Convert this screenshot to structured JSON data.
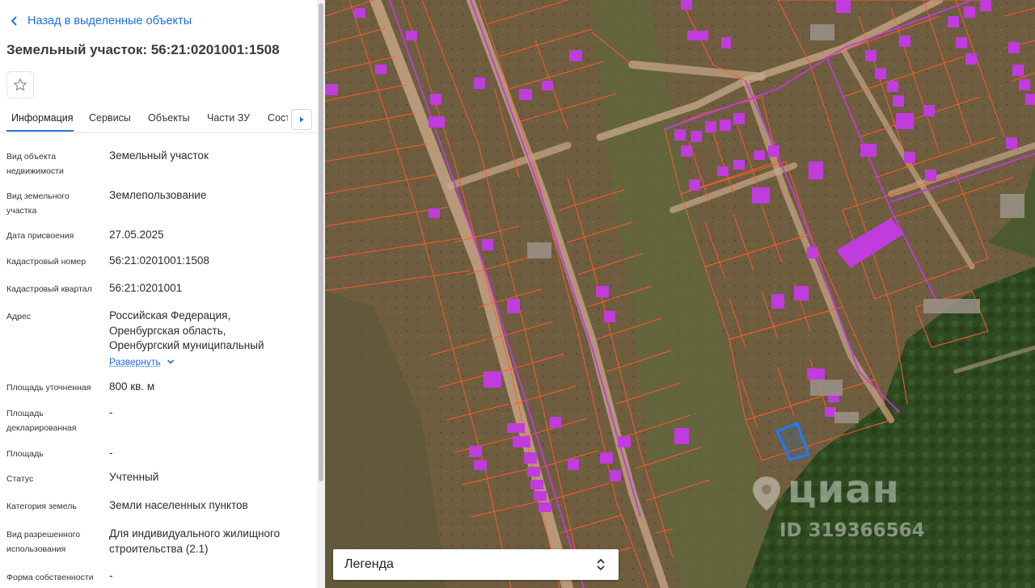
{
  "back_link": "Назад в выделенные объекты",
  "title": "Земельный участок: 56:21:0201001:1508",
  "tabs": [
    "Информация",
    "Сервисы",
    "Объекты",
    "Части ЗУ",
    "Соста"
  ],
  "fields": [
    {
      "label": "Вид объекта недвижимости",
      "value": "Земельный участок"
    },
    {
      "label": "Вид земельного участка",
      "value": "Землепользование"
    },
    {
      "label": "Дата присвоения",
      "value": "27.05.2025"
    },
    {
      "label": "Кадастровый номер",
      "value": "56:21:0201001:1508"
    },
    {
      "label": "Кадастровый квартал",
      "value": "56:21:0201001"
    },
    {
      "label": "Адрес",
      "value": "Российская Федерация, Оренбургская область, Оренбургский муниципальный"
    },
    {
      "label": "Площадь уточненная",
      "value": "800 кв. м"
    },
    {
      "label": "Площадь декларированная",
      "value": "-"
    },
    {
      "label": "Площадь",
      "value": "-"
    },
    {
      "label": "Статус",
      "value": "Учтенный"
    },
    {
      "label": "Категория земель",
      "value": "Земли населенных пунктов"
    },
    {
      "label": "Вид разрешенного использования",
      "value": "Для индивидуального жилищного строительства (2.1)"
    },
    {
      "label": "Форма собственности",
      "value": "-"
    }
  ],
  "expand_label": "Развернуть",
  "legend_label": "Легенда",
  "watermark": {
    "brand": "циан",
    "id": "ID 319366564"
  },
  "colors": {
    "accent": "#1d6fe0",
    "parcel_border": "#ff5a2a",
    "building": "#c03cdc",
    "selected": "#1e7bff"
  },
  "icons": [
    "chevron-left-icon",
    "star-icon",
    "chevron-right-icon",
    "chevron-down-icon",
    "sort-icon",
    "map-pin-icon"
  ]
}
